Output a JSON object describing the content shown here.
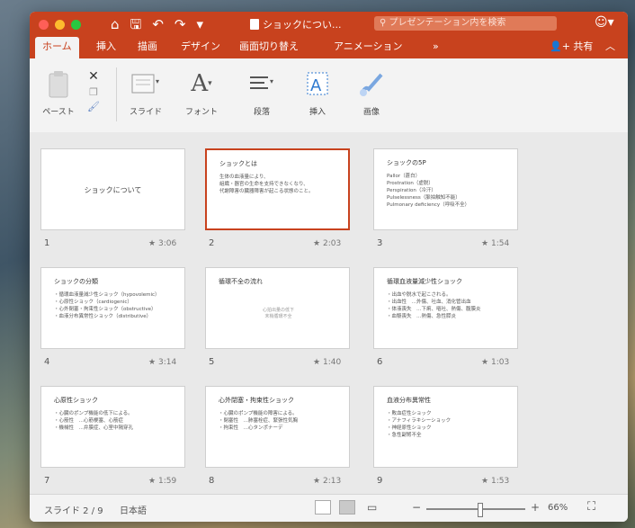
{
  "titlebar": {
    "quick_access": [
      "⌂",
      "🖫",
      "↶",
      "↷",
      "▾"
    ],
    "doc_title": "ショックについ...",
    "search_placeholder": "プレゼンテーション内を検索",
    "account_icon": "smiley-icon"
  },
  "ribbon_tabs": [
    "ホーム",
    "挿入",
    "描画",
    "デザイン",
    "画面切り替え",
    "アニメーション",
    "»"
  ],
  "active_tab": "ホーム",
  "share_label": "共有",
  "ribbon": {
    "paste": "ペースト",
    "slide": "スライド",
    "font": "フォント",
    "paragraph": "段落",
    "insert": "挿入",
    "drawing": "画像"
  },
  "slides": [
    {
      "number": "1",
      "duration": "3:06",
      "title": "",
      "center_title": "ショックについて",
      "body": []
    },
    {
      "number": "2",
      "duration": "2:03",
      "title": "ショックとは",
      "center_title": "",
      "body": [
        "生体の血液量により、",
        "組織・器官の生命を支持できなくなり、",
        "代謝障害の臓器障害が起こる状態のこと。"
      ],
      "selected": true
    },
    {
      "number": "3",
      "duration": "1:54",
      "title": "ショックの5P",
      "center_title": "",
      "body": [
        "Pallor（蒼白）",
        "Prostration（虚脱）",
        "Perspiration（冷汗）",
        "Pulselessness（脈拍触知不能）",
        "Pulmonary deficiency（呼吸不全）"
      ]
    },
    {
      "number": "4",
      "duration": "3:14",
      "title": "ショックの分類",
      "center_title": "",
      "body": [
        "・循環血液量減少性ショック（hypovolemic）",
        "・心原性ショック（cardiogenic）",
        "・心外閉塞・拘束性ショック（obstructive）",
        "・血液分布異常性ショック（distributive）"
      ]
    },
    {
      "number": "5",
      "duration": "1:40",
      "title": "循環不全の流れ",
      "center_title": "",
      "body": [],
      "caption": "心拍出量の低下\n末梢循環不全"
    },
    {
      "number": "6",
      "duration": "1:03",
      "title": "循環血液量減少性ショック",
      "center_title": "",
      "body": [
        "・出血や脱水で起こされる。",
        "・出血性　…外傷、吐血、消化管出血",
        "・体液喪失　…下痢、嘔吐、熱傷、腹膜炎",
        "・血漿喪失　…熱傷、急性膵炎"
      ]
    },
    {
      "number": "7",
      "duration": "1:59",
      "title": "心原性ショック",
      "center_title": "",
      "body": [
        "・心臓のポンプ機能の低下による。",
        "・心筋性　…心筋梗塞、心筋症",
        "・機械性　…弁膜症、心室中隔穿孔"
      ]
    },
    {
      "number": "8",
      "duration": "2:13",
      "title": "心外閉塞・拘束性ショック",
      "center_title": "",
      "body": [
        "・心臓のポンプ機能の障害による。",
        "・閉塞性　…肺塞栓症、緊張性気胸",
        "・拘束性　…心タンポナーデ"
      ]
    },
    {
      "number": "9",
      "duration": "1:53",
      "title": "血液分布異常性",
      "center_title": "",
      "body": [
        "・敗血症性ショック",
        "・アナフィラキシーショック",
        "・神経原性ショック",
        "・急性副腎不全"
      ]
    }
  ],
  "statusbar": {
    "slide_position": "スライド 2 / 9",
    "language": "日本語",
    "zoom": "66%"
  },
  "colors": {
    "accent": "#c8421e",
    "selected_border": "#c8421e"
  }
}
